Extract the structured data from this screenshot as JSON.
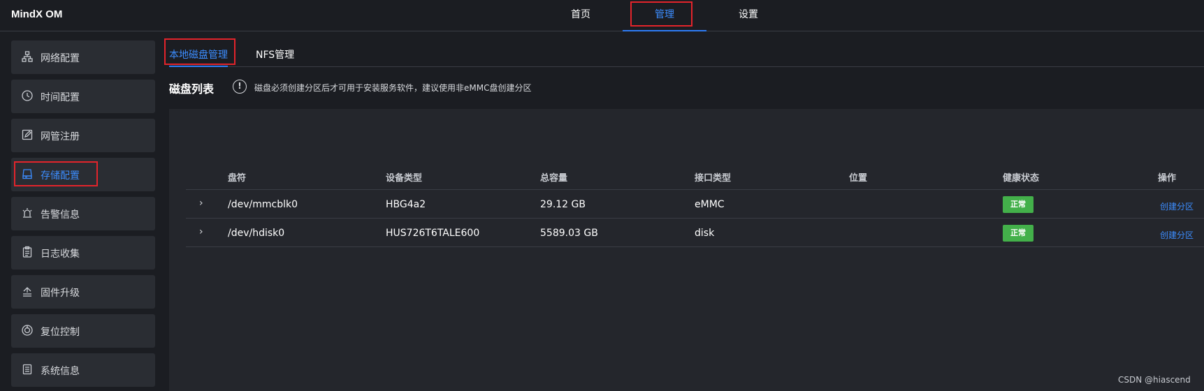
{
  "app": {
    "title": "MindX OM"
  },
  "nav": {
    "items": [
      "首页",
      "管理",
      "设置"
    ],
    "active": "管理"
  },
  "sidebar": {
    "items": [
      {
        "label": "网络配置",
        "icon": "network-icon"
      },
      {
        "label": "时间配置",
        "icon": "clock-icon"
      },
      {
        "label": "网管注册",
        "icon": "edit-icon"
      },
      {
        "label": "存储配置",
        "icon": "storage-icon",
        "active": true
      },
      {
        "label": "告警信息",
        "icon": "alarm-icon"
      },
      {
        "label": "日志收集",
        "icon": "clipboard-icon"
      },
      {
        "label": "固件升级",
        "icon": "upgrade-icon"
      },
      {
        "label": "复位控制",
        "icon": "power-icon"
      },
      {
        "label": "系统信息",
        "icon": "document-icon"
      }
    ]
  },
  "tabs": {
    "items": [
      "本地磁盘管理",
      "NFS管理"
    ],
    "active": "本地磁盘管理"
  },
  "section": {
    "title": "磁盘列表",
    "info_icon": "!",
    "hint": "磁盘必须创建分区后才可用于安装服务软件，建议使用非eMMC盘创建分区"
  },
  "table": {
    "columns": [
      "盘符",
      "设备类型",
      "总容量",
      "接口类型",
      "位置",
      "健康状态",
      "操作"
    ],
    "rows": [
      {
        "expand": "›",
        "device": "/dev/mmcblk0",
        "type": "HBG4a2",
        "capacity": "29.12 GB",
        "interface": "eMMC",
        "location": "",
        "health": "正常",
        "action": "创建分区"
      },
      {
        "expand": "›",
        "device": "/dev/hdisk0",
        "type": "HUS726T6TALE600",
        "capacity": "5589.03 GB",
        "interface": "disk",
        "location": "",
        "health": "正常",
        "action": "创建分区"
      }
    ]
  },
  "watermark": "CSDN @hiascend",
  "colors": {
    "accent": "#2e7cf6",
    "highlight_box": "#e3242b",
    "health_ok": "#43b04a"
  }
}
